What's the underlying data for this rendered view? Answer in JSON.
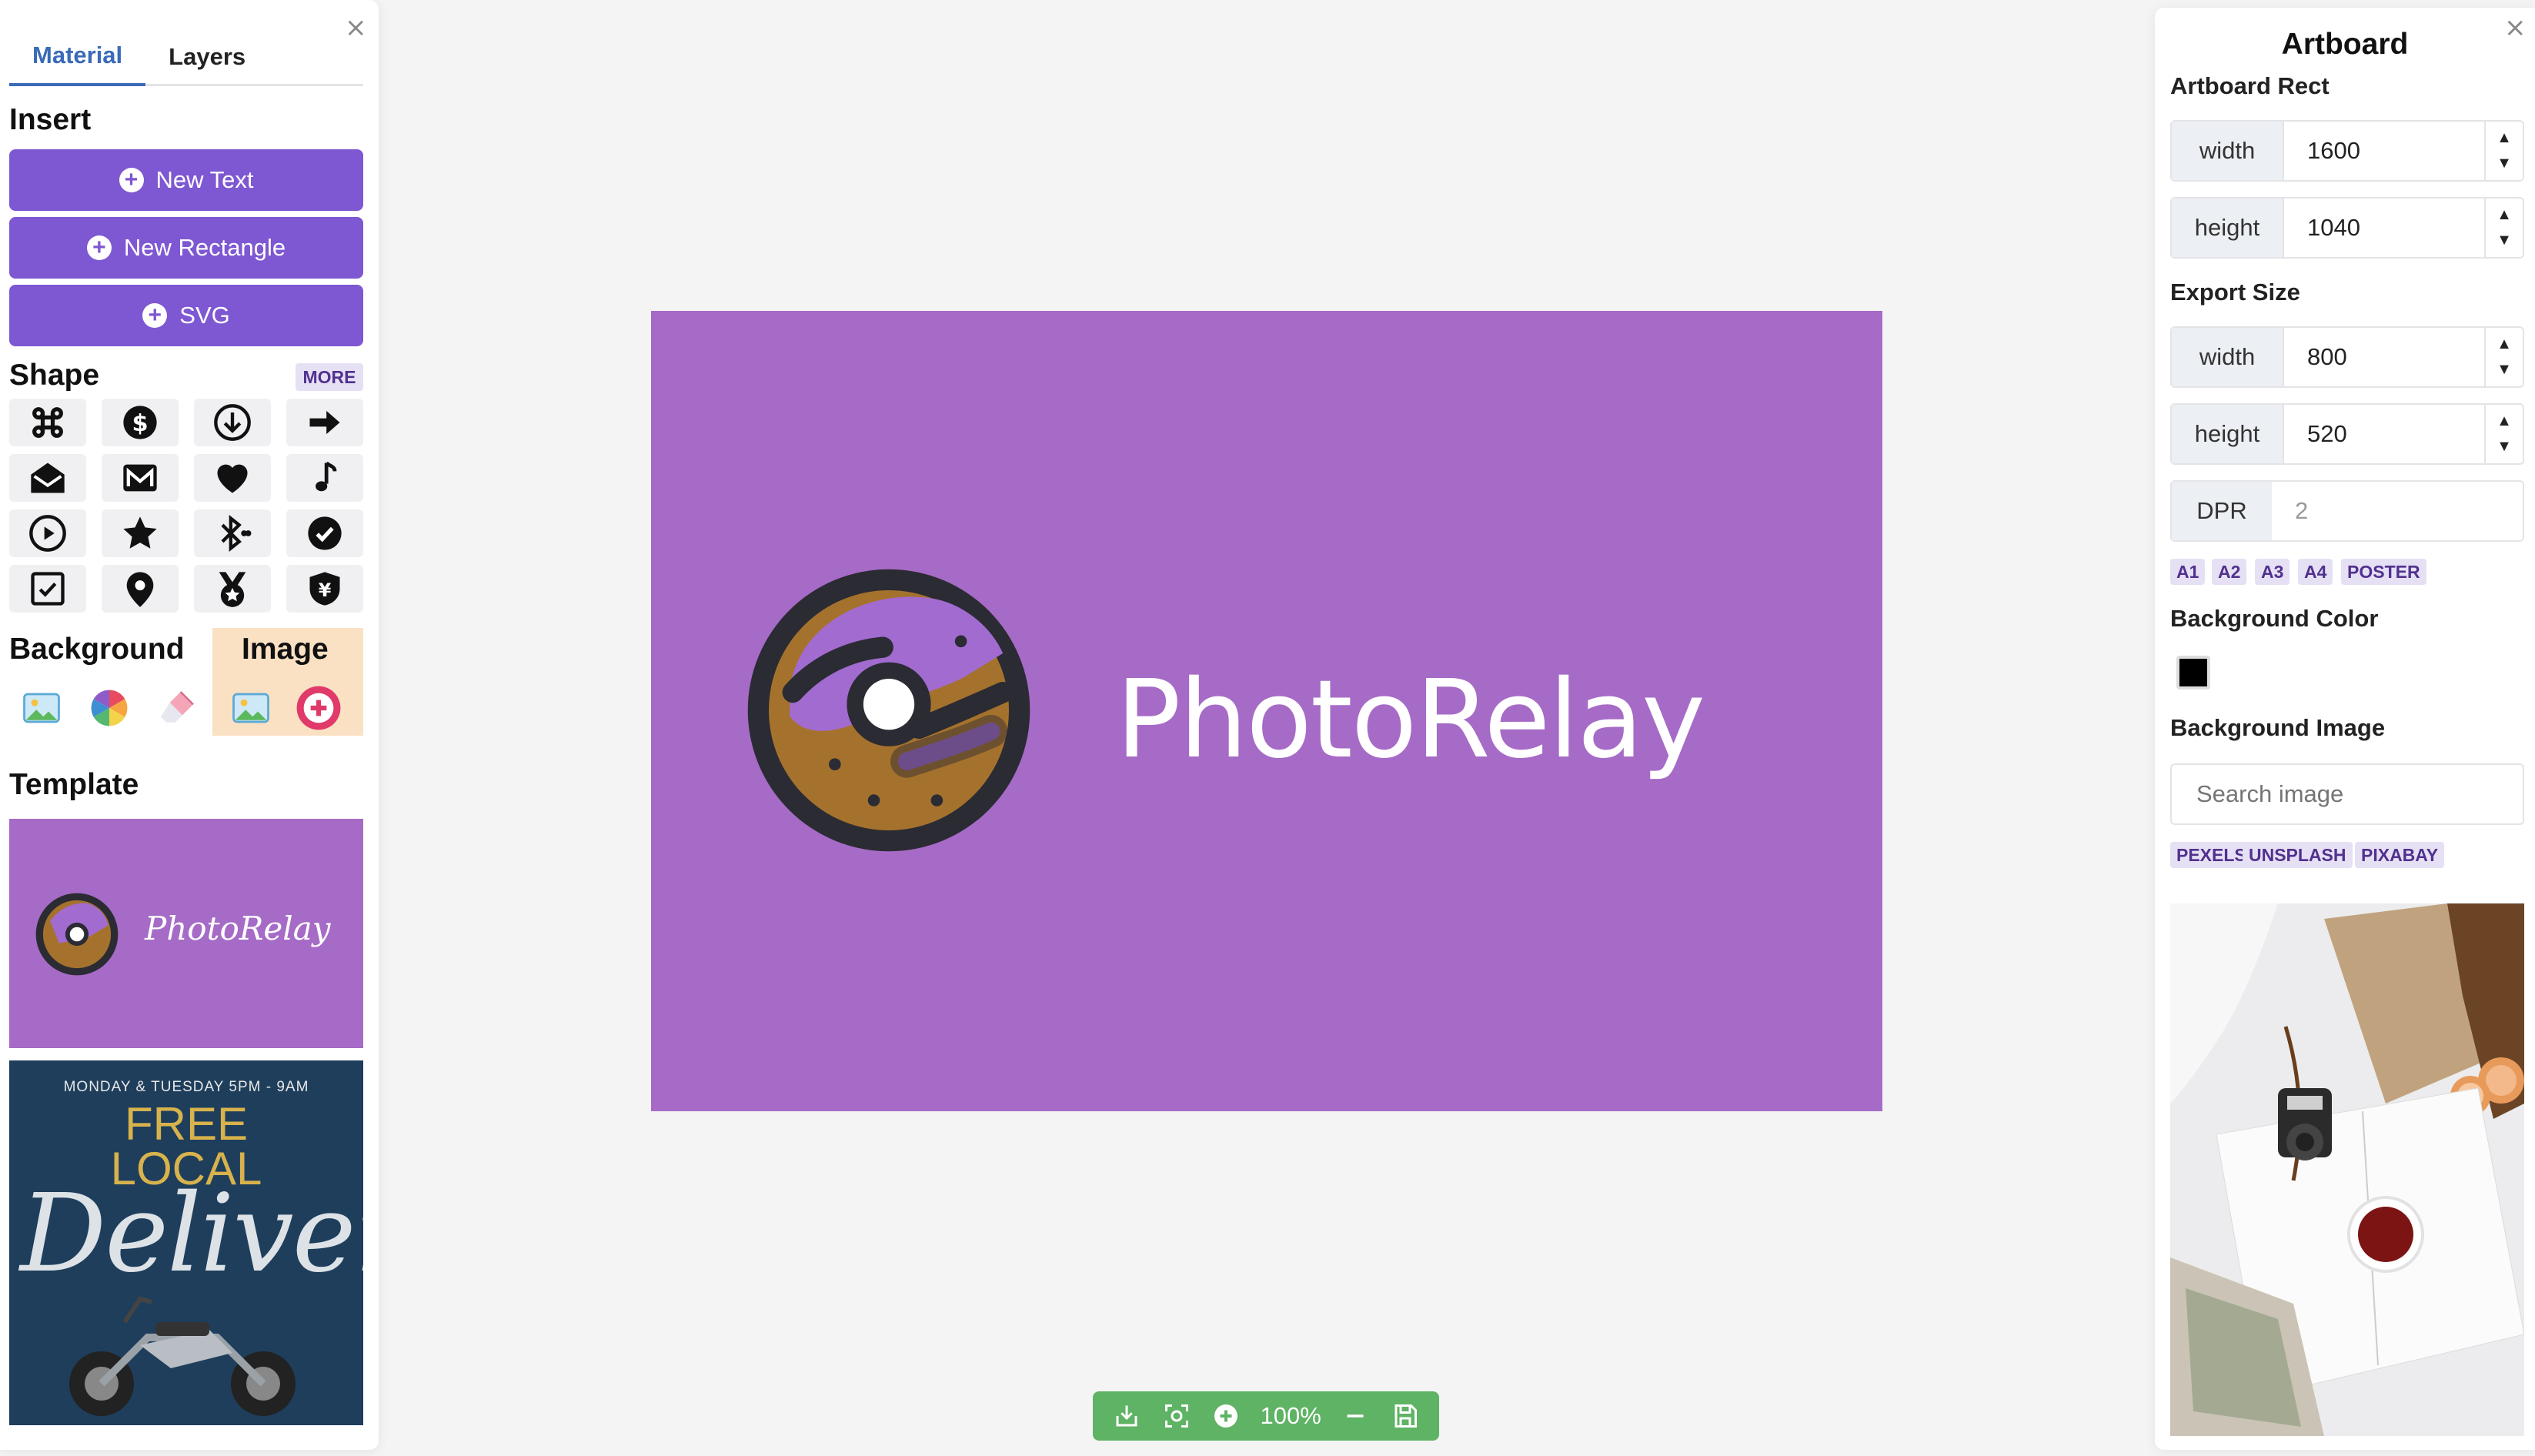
{
  "left_panel": {
    "tabs": [
      {
        "label": "Material",
        "active": true
      },
      {
        "label": "Layers",
        "active": false
      }
    ],
    "insert": {
      "title": "Insert",
      "buttons": [
        "New Text",
        "New Rectangle",
        "SVG"
      ]
    },
    "shape": {
      "title": "Shape",
      "more_label": "MORE",
      "icons": [
        "command-icon",
        "dollar-circle-icon",
        "arrow-down-circle-icon",
        "arrow-right-icon",
        "envelope-open-icon",
        "gmail-icon",
        "heart-icon",
        "music-note-icon",
        "play-circle-icon",
        "star-icon",
        "bluetooth-icon",
        "check-circle-icon",
        "checkbox-icon",
        "map-pin-icon",
        "medal-icon",
        "yen-shield-icon"
      ]
    },
    "background": {
      "title": "Background",
      "icons": [
        "image-icon",
        "color-wheel-icon",
        "eraser-icon"
      ]
    },
    "image": {
      "title": "Image",
      "icons": [
        "image-icon",
        "add-circle-icon"
      ]
    },
    "template": {
      "title": "Template",
      "cards": [
        {
          "brand": "PhotoRelay",
          "color": "#a66bc6"
        },
        {
          "top_line": "MONDAY & TUESDAY 5PM - 9AM",
          "headline_1": "FREE",
          "headline_2": "LOCAL",
          "script": "Deliver"
        }
      ]
    }
  },
  "canvas": {
    "brand_text": "PhotoRelay",
    "background": "#a66bc6",
    "zoom_level": "100%"
  },
  "right_panel": {
    "title": "Artboard",
    "artboard_rect": {
      "label": "Artboard Rect",
      "width_label": "width",
      "width": "1600",
      "height_label": "height",
      "height": "1040"
    },
    "export_size": {
      "label": "Export Size",
      "width_label": "width",
      "width": "800",
      "height_label": "height",
      "height": "520",
      "dpr_label": "DPR",
      "dpr_placeholder": "2",
      "presets": [
        "A1",
        "A2",
        "A3",
        "A4",
        "POSTER"
      ]
    },
    "background_color": {
      "label": "Background Color",
      "value": "#000000"
    },
    "background_image": {
      "label": "Background Image",
      "search_placeholder": "Search image",
      "sources": [
        "PEXELS",
        "UNSPLASH",
        "PIXABAY"
      ]
    }
  },
  "colors": {
    "accent": "#7e57d2",
    "tab_active": "#3a6ab8",
    "toolbar_green": "#5eb364",
    "artboard_purple": "#a66bc6"
  }
}
